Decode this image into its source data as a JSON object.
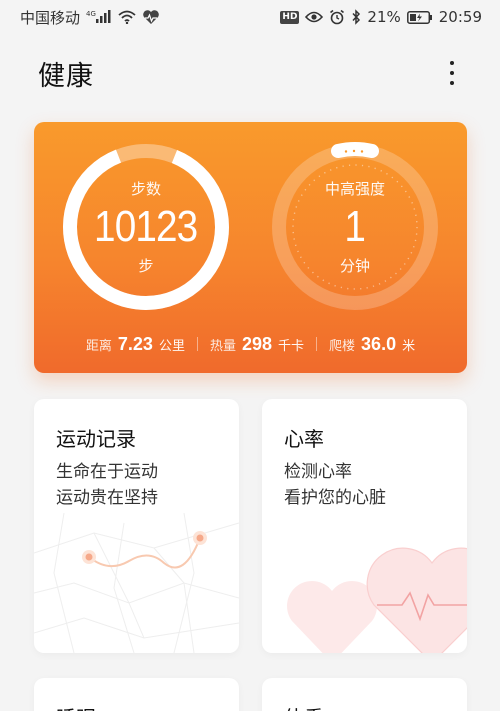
{
  "status_bar": {
    "carrier": "中国移动",
    "network": "4G",
    "hd": "HD",
    "battery": "21%",
    "time": "20:59"
  },
  "header": {
    "title": "健康"
  },
  "summary": {
    "steps": {
      "label": "步数",
      "value": "10123",
      "unit": "步"
    },
    "intensity": {
      "label": "中高强度",
      "value": "1",
      "unit": "分钟"
    },
    "stats": [
      {
        "label": "距离",
        "value": "7.23",
        "unit": "公里"
      },
      {
        "label": "热量",
        "value": "298",
        "unit": "千卡"
      },
      {
        "label": "爬楼",
        "value": "36.0",
        "unit": "米"
      }
    ],
    "colors": {
      "start": "#f99a2c",
      "end": "#f06a2c"
    }
  },
  "cards": [
    {
      "title": "运动记录",
      "lines": [
        "生命在于运动",
        "运动贵在坚持"
      ]
    },
    {
      "title": "心率",
      "lines": [
        "检测心率",
        "看护您的心脏"
      ]
    },
    {
      "title": "睡眠",
      "lines": []
    },
    {
      "title": "体重",
      "lines": []
    }
  ]
}
